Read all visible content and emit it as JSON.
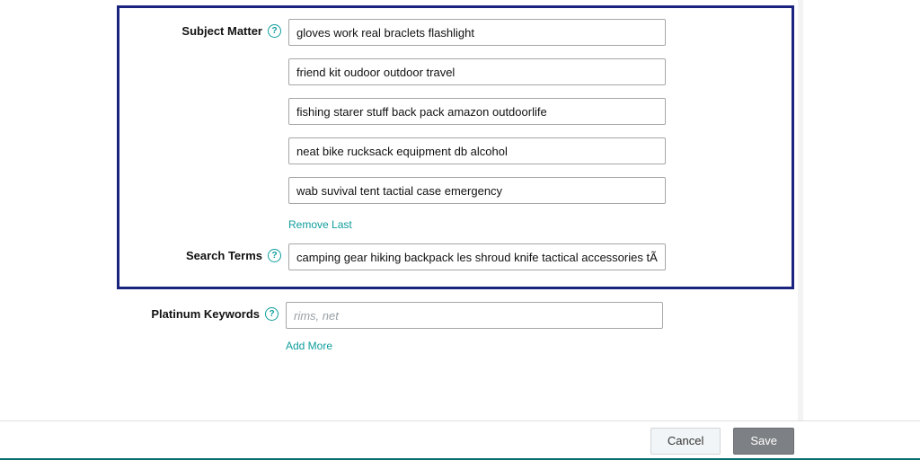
{
  "subjectMatter": {
    "label": "Subject Matter",
    "fields": [
      "gloves work real braclets flashlight",
      "friend kit oudoor outdoor travel",
      "fishing starer stuff back pack amazon outdoorlife",
      "neat bike rucksack equipment db alcohol",
      "wab suvival tent tactial case emergency"
    ],
    "removeLast": "Remove Last"
  },
  "searchTerms": {
    "label": "Search Terms",
    "value": "camping gear hiking backpack les shroud knife tactical accessories tÃ¡ctical s"
  },
  "platinumKeywords": {
    "label": "Platinum Keywords",
    "placeholder": "rims, net",
    "addMore": "Add More"
  },
  "footer": {
    "cancel": "Cancel",
    "save": "Save"
  }
}
